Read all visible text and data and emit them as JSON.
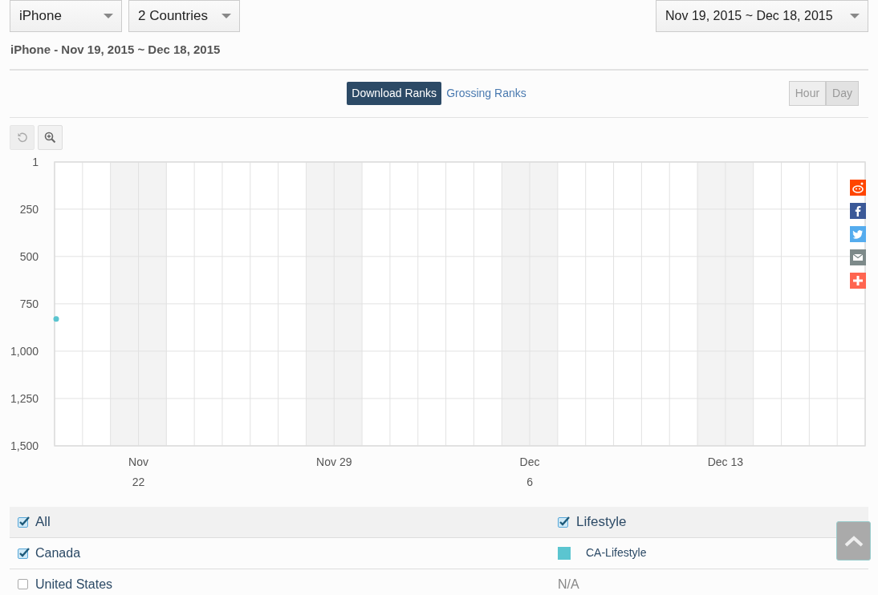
{
  "filters": [
    {
      "label": "iPhone"
    },
    {
      "label": "2 Countries"
    }
  ],
  "date_range": {
    "label": "Nov 19, 2015 ~ Dec 18, 2015"
  },
  "heading": "iPhone - Nov 19, 2015 ~ Dec 18, 2015",
  "rank_tabs": [
    {
      "label": "Download Ranks",
      "selected": true
    },
    {
      "label": "Grossing Ranks",
      "selected": false
    }
  ],
  "granularity": [
    {
      "label": "Hour",
      "selected": false
    },
    {
      "label": "Day",
      "selected": true
    }
  ],
  "chart_tools": [
    {
      "kind": "reset",
      "disabled": true
    },
    {
      "kind": "zoom",
      "disabled": false
    }
  ],
  "chart": {
    "chart_data": {
      "type": "line",
      "categories": [
        null,
        null,
        null,
        "Nov 22",
        null,
        null,
        null,
        null,
        null,
        null,
        "Nov 29",
        null,
        null,
        null,
        null,
        null,
        null,
        "Dec 6",
        null,
        null,
        null,
        null,
        null,
        null,
        "Dec 13",
        null,
        null,
        null,
        null,
        null
      ],
      "series": [
        {
          "name": "CA-Lifestyle",
          "color": "#5bc5d0",
          "marker": true,
          "values": [
            830,
            null,
            null,
            null,
            null,
            null,
            null,
            null,
            null,
            null,
            null,
            null,
            null,
            null,
            null,
            null,
            null,
            null,
            null,
            null,
            null,
            null,
            null,
            null,
            null,
            null,
            null,
            null,
            null,
            null
          ]
        }
      ],
      "ylim": [
        1500,
        1
      ],
      "yticks": [
        1,
        250,
        500,
        750,
        {
          "value": 1000,
          "label": "1,000"
        },
        {
          "value": 1250,
          "label": "1,250"
        },
        {
          "value": 1500,
          "label": "1,500"
        }
      ],
      "grid": true
    }
  },
  "table": {
    "header": {
      "label": "All",
      "checked": true,
      "category": "Lifestyle",
      "category_checked": true
    },
    "rows": [
      {
        "country": "Canada",
        "checked": true,
        "kind": "series"
      },
      {
        "country": "United States",
        "checked": false,
        "kind": "text",
        "value": "N/A"
      }
    ]
  }
}
